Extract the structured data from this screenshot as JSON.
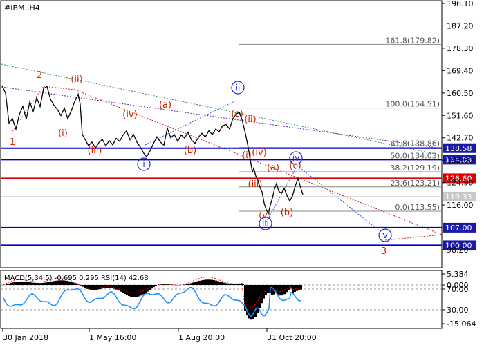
{
  "chart_data": [
    {
      "type": "line",
      "title": "#IBM.,H4",
      "y_ticks": [
        196.1,
        187.2,
        178.3,
        169.4,
        160.5,
        151.6,
        142.7,
        133.8,
        124.9,
        116.0,
        98.2
      ],
      "y_tick_labels": [
        "196.10",
        "187.20",
        "178.30",
        "169.40",
        "160.50",
        "151.60",
        "142.70",
        "133.80",
        "124.90",
        "116.00",
        "98.20"
      ],
      "ylim": [
        94.8,
        197.5
      ],
      "x_tick_labels": [
        "30 Jan 2018",
        "1 May 16:00",
        "1 Aug 20:00",
        "31 Oct 20:00"
      ],
      "series": [
        {
          "color": "#000000",
          "values": [
            [
              0,
              163.5
            ],
            [
              5,
              160.4
            ],
            [
              10,
              148.5
            ],
            [
              15,
              150.3
            ],
            [
              20,
              146.1
            ],
            [
              25,
              152.0
            ],
            [
              30,
              155.2
            ],
            [
              35,
              150.1
            ],
            [
              40,
              157.0
            ],
            [
              45,
              153.2
            ],
            [
              50,
              158.6
            ],
            [
              55,
              155.1
            ],
            [
              60,
              162.3
            ],
            [
              65,
              163.1
            ],
            [
              70,
              158.0
            ],
            [
              75,
              155.6
            ],
            [
              80,
              154.0
            ],
            [
              85,
              151.5
            ],
            [
              90,
              154.5
            ],
            [
              95,
              150.3
            ],
            [
              100,
              153.4
            ],
            [
              105,
              157.1
            ],
            [
              110,
              160.0
            ],
            [
              113,
              156.0
            ],
            [
              116,
              144.0
            ],
            [
              120,
              142.1
            ],
            [
              125,
              139.6
            ],
            [
              130,
              141.0
            ],
            [
              135,
              138.7
            ],
            [
              140,
              140.8
            ],
            [
              145,
              142.1
            ],
            [
              150,
              139.5
            ],
            [
              155,
              141.6
            ],
            [
              160,
              139.9
            ],
            [
              165,
              142.5
            ],
            [
              170,
              141.3
            ],
            [
              175,
              143.8
            ],
            [
              180,
              145.5
            ],
            [
              185,
              141.9
            ],
            [
              190,
              144.1
            ],
            [
              195,
              141.0
            ],
            [
              200,
              139.0
            ],
            [
              205,
              136.5
            ],
            [
              209,
              135.2
            ],
            [
              214,
              137.5
            ],
            [
              219,
              140.5
            ],
            [
              224,
              143.1
            ],
            [
              229,
              141.0
            ],
            [
              234,
              139.8
            ],
            [
              239,
              146.5
            ],
            [
              244,
              142.7
            ],
            [
              249,
              144.0
            ],
            [
              254,
              141.3
            ],
            [
              259,
              143.8
            ],
            [
              264,
              142.6
            ],
            [
              269,
              144.9
            ],
            [
              274,
              141.8
            ],
            [
              279,
              140.5
            ],
            [
              284,
              142.9
            ],
            [
              289,
              144.5
            ],
            [
              294,
              143.0
            ],
            [
              299,
              145.5
            ],
            [
              304,
              144.0
            ],
            [
              309,
              146.2
            ],
            [
              314,
              145.1
            ],
            [
              319,
              147.5
            ],
            [
              324,
              148.0
            ],
            [
              329,
              146.2
            ],
            [
              334,
              150.5
            ],
            [
              339,
              152.2
            ],
            [
              343,
              152.8
            ],
            [
              347,
              150.0
            ],
            [
              351,
              145.5
            ],
            [
              355,
              140.3
            ],
            [
              359,
              134.0
            ],
            [
              362,
              129.0
            ],
            [
              364,
              130.6
            ],
            [
              367,
              127.5
            ],
            [
              370,
              125.8
            ],
            [
              373,
              123.0
            ],
            [
              376,
              121.2
            ],
            [
              379,
              116.8
            ],
            [
              382,
              114.2
            ],
            [
              385,
              112.6
            ],
            [
              388,
              116.0
            ],
            [
              391,
              118.8
            ],
            [
              394,
              122.4
            ],
            [
              397,
              124.6
            ],
            [
              400,
              121.6
            ],
            [
              404,
              120.6
            ],
            [
              408,
              122.6
            ],
            [
              412,
              119.8
            ],
            [
              416,
              117.6
            ],
            [
              420,
              119.6
            ],
            [
              424,
              123.5
            ],
            [
              428,
              126.6
            ],
            [
              432,
              122.8
            ],
            [
              435,
              120.2
            ]
          ]
        },
        {
          "name": "fib",
          "values": []
        }
      ],
      "fib_levels": [
        {
          "label": "161.8(179.82)",
          "value": 179.82
        },
        {
          "label": "100.0(154.51)",
          "value": 154.51
        },
        {
          "label": "61.8(138.86)",
          "value": 138.86
        },
        {
          "label": "50.0(134.03)",
          "value": 134.03
        },
        {
          "label": "38.2(129.19)",
          "value": 129.19
        },
        {
          "label": "23.6(123.21)",
          "value": 123.21
        },
        {
          "label": "0.0(113.55)",
          "value": 113.55
        }
      ],
      "level_lines": [
        {
          "label": "138.58",
          "value": 138.58,
          "color": "#0000cc",
          "label_bg": "#1a1aa6"
        },
        {
          "label": "134.03",
          "value": 134.03,
          "color": "#0000cc",
          "label_bg": "#1a1aa6"
        },
        {
          "label": "126.60",
          "value": 126.6,
          "color": "#dd0000",
          "label_bg": "#dd0000"
        },
        {
          "label": "107.00",
          "value": 107.0,
          "color": "#0000cc",
          "label_bg": "#1a1aa6"
        },
        {
          "label": "100.00",
          "value": 100.0,
          "color": "#0000cc",
          "label_bg": "#1a1aa6"
        }
      ],
      "current_price": {
        "label": "119.33",
        "value": 119.33
      },
      "wave_labels": [
        {
          "text": "1",
          "color": "#cc2200"
        },
        {
          "text": "2",
          "color": "#cc2200"
        },
        {
          "text": "(ii)",
          "color": "#cc2200"
        },
        {
          "text": "(i)",
          "color": "#cc2200"
        },
        {
          "text": "(iii)",
          "color": "#cc2200"
        },
        {
          "text": "(iv)",
          "color": "#cc2200"
        },
        {
          "text": "(a)",
          "color": "#cc2200"
        },
        {
          "text": "(b)",
          "color": "#cc2200"
        },
        {
          "text": "(c)",
          "color": "#cc2200"
        },
        {
          "text": "(ii)",
          "color": "#cc2200"
        },
        {
          "text": "(i)",
          "color": "#cc2200"
        },
        {
          "text": "(iv)",
          "color": "#cc2200"
        },
        {
          "text": "(iii)",
          "color": "#cc2200"
        },
        {
          "text": "(a)",
          "color": "#cc2200"
        },
        {
          "text": "(c)",
          "color": "#cc2200"
        },
        {
          "text": "(b)",
          "color": "#cc2200"
        },
        {
          "text": "(v)",
          "color": "#cc2200"
        },
        {
          "text": "3",
          "color": "#cc2200"
        }
      ],
      "circled_labels": [
        {
          "text": "i",
          "color": "#2222cc"
        },
        {
          "text": "ii",
          "color": "#2222cc"
        },
        {
          "text": "iii",
          "color": "#2222cc"
        },
        {
          "text": "iv",
          "color": "#2222cc"
        },
        {
          "text": "v",
          "color": "#2222cc"
        }
      ]
    },
    {
      "type": "area",
      "title": "MACD(5,34,5) -0.695 0.295 RSI(14) 42.68",
      "y_tick_labels": [
        "5.384",
        "0.000",
        "70.00",
        "30.00",
        "-15.064"
      ],
      "series": [
        {
          "name": "RSI(14)",
          "color": "#1e90ff"
        },
        {
          "name": "MACD histogram",
          "color": "#000000"
        },
        {
          "name": "MACD signal",
          "color": "#ff0000"
        }
      ]
    }
  ]
}
